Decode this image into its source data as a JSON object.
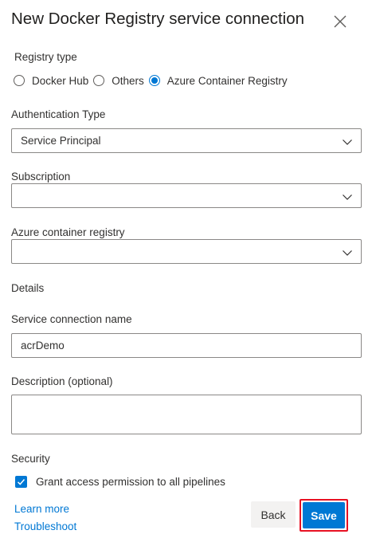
{
  "dialog": {
    "title": "New Docker Registry service connection",
    "close_icon": "close-icon"
  },
  "registry_type": {
    "label": "Registry type",
    "options": [
      {
        "label": "Docker Hub",
        "checked": false
      },
      {
        "label": "Others",
        "checked": false
      },
      {
        "label": "Azure Container Registry",
        "checked": true
      }
    ]
  },
  "authentication": {
    "label": "Authentication Type",
    "value": "Service Principal"
  },
  "subscription": {
    "label": "Subscription",
    "value": ""
  },
  "container_registry": {
    "label": "Azure container registry",
    "value": ""
  },
  "details": {
    "heading": "Details",
    "connection_name_label": "Service connection name",
    "connection_name_value": "acrDemo",
    "description_label": "Description (optional)",
    "description_value": ""
  },
  "security": {
    "heading": "Security",
    "grant_access_label": "Grant access permission to all pipelines",
    "grant_access_checked": true
  },
  "footer": {
    "learn_more": "Learn more",
    "troubleshoot": "Troubleshoot",
    "back_label": "Back",
    "save_label": "Save"
  },
  "colors": {
    "accent": "#0078d4",
    "highlight": "#e81123",
    "border": "#8a8886",
    "text": "#323130"
  }
}
